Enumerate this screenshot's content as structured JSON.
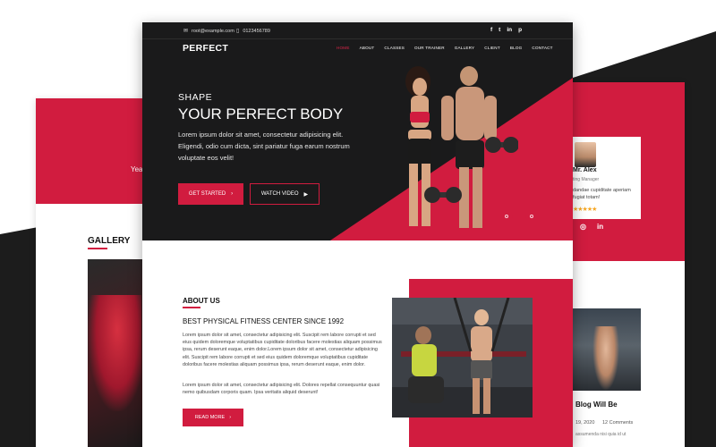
{
  "colors": {
    "accent": "#d11c3f",
    "dark": "#1a1a1b",
    "stars": "#f5a623"
  },
  "back_left": {
    "year_text": "Yea",
    "gallery_title": "GALLERY"
  },
  "back_right": {
    "testimonial": {
      "name": "Mr. Alex",
      "role": "ting Manager",
      "text": "dandae cupiditate aperiam fugiat totam!",
      "stars": "★★★★★"
    },
    "social_icons": [
      "twitter-icon",
      "instagram-icon",
      "linkedin-icon"
    ],
    "social_glyphs": {
      "twitter": "",
      "instagram": "◎",
      "linkedin": "in"
    },
    "blog": {
      "title": "Blog Will Be",
      "date": "19, 2020",
      "comments": "12 Comments",
      "excerpt": "assumenda nisi quia id ut"
    }
  },
  "topbar": {
    "email": "root@example.com",
    "phone": "0123456789",
    "social": {
      "facebook": "f",
      "twitter": "t",
      "linkedin": "in",
      "pinterest": "p"
    }
  },
  "header": {
    "logo": "PERFECT",
    "nav": [
      "HOME",
      "ABOUT",
      "CLASSES",
      "OUR TRAINER",
      "GALLERY",
      "CLIENT",
      "BLOG",
      "CONTACT"
    ],
    "active_nav": "HOME"
  },
  "hero": {
    "subtitle": "SHAPE",
    "title": "YOUR PERFECT BODY",
    "description": "Lorem ipsum dolor sit amet, consectetur adipisicing elit. Eligendi, odio cum dicta, sint pariatur fuga earum nostrum voluptate eos velit!",
    "primary_button": "GET STARTED",
    "secondary_button": "WATCH VIDEO",
    "slide_count": 3,
    "active_slide": 1
  },
  "about": {
    "title": "ABOUT US",
    "heading": "BEST PHYSICAL FITNESS CENTER SINCE 1992",
    "paragraph1": "Lorem ipsum dolor sit amet, consectetur adipisicing elit. Suscipit rem labore corrupti et sed eius quidem doloremque voluptatibus cupiditate doloribus facere molestias aliquam possimus ipsa, rerum deserunt eaque, enim dolor.Lorem ipsum dolor sit amet, consectetur adipisicing elit. Suscipit rem labore corrupti et sed eius quidem doloremque voluptatibus cupiditate doloribus facere molestias aliquam possimus ipsa, rerum deserunt eaque, enim dolor.",
    "paragraph2": "Lorem ipsum dolor sit amet, consectetur adipisicing elit. Dolores repellat consequuntur quasi nemo quibusdam corporis quam. Ipsa veritatis aliquid deserunt!",
    "button": "READ MORE"
  }
}
